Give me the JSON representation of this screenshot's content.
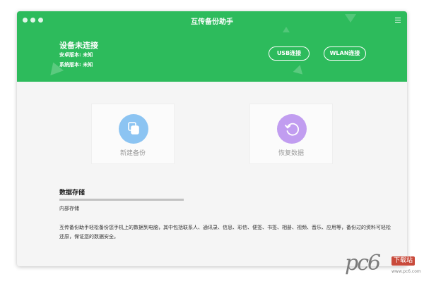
{
  "window": {
    "title": "互传备份助手"
  },
  "header": {
    "device_status": "设备未连接",
    "android_version": "安卓版本: 未知",
    "system_version": "系统版本: 未知",
    "usb_button": "USB连接",
    "wlan_button": "WLAN连接",
    "accent_color": "#2dbb5c"
  },
  "actions": [
    {
      "label": "新建备份",
      "icon": "copy-icon",
      "color": "#8cc4f2"
    },
    {
      "label": "恢复数据",
      "icon": "restore-icon",
      "color": "#c19df0"
    }
  ],
  "storage": {
    "title": "数据存储",
    "label": "内部存储",
    "used_fraction": 0.0
  },
  "description": "互传备份助手轻松备份您手机上的数据到电脑，其中包括联系人、通讯录、信息、彩信、便签、书签、相册、视频、音乐、应用等，备份过的资料可轻松还原，保证您的数据安全。",
  "watermark": {
    "brand": "pc6",
    "tag": "下载站",
    "url": "www.pc6.com"
  }
}
